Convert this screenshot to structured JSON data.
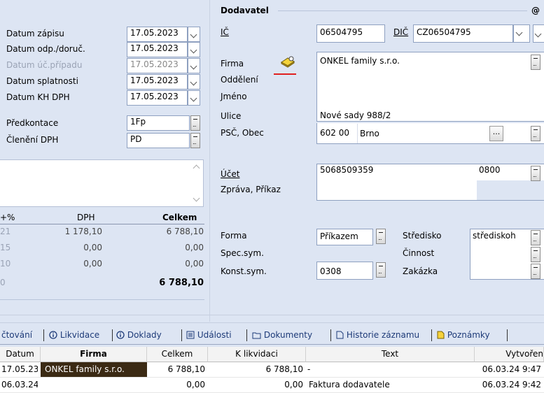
{
  "left": {
    "dates": [
      {
        "label": "Datum zápisu",
        "value": "17.05.2023",
        "disabled": false
      },
      {
        "label": "Datum odp./doruč.",
        "value": "17.05.2023",
        "disabled": false
      },
      {
        "label": "Datum úč.případu",
        "value": "17.05.2023",
        "disabled": true
      },
      {
        "label": "Datum splatnosti",
        "value": "17.05.2023",
        "disabled": false
      },
      {
        "label": "Datum KH DPH",
        "value": "17.05.2023",
        "disabled": false
      }
    ],
    "predkontace_label": "Předkontace",
    "predkontace_value": "1Fp",
    "cleneni_label": "Členění DPH",
    "cleneni_value": "PD",
    "vat_headers": {
      "rate": "+%",
      "dph": "DPH",
      "celkem": "Celkem"
    },
    "vat_rows": [
      {
        "rate": "21",
        "dph": "1 178,10",
        "celkem": "6 788,10"
      },
      {
        "rate": "15",
        "dph": "0,00",
        "celkem": "0,00"
      },
      {
        "rate": "10",
        "dph": "0,00",
        "celkem": "0,00"
      },
      {
        "rate": "0",
        "dph": "",
        "celkem": "6 788,10"
      }
    ]
  },
  "supplier": {
    "section_title": "Dodavatel",
    "at_symbol": "@",
    "ic_label": "IČ",
    "ic_value": "06504795",
    "dic_label": "DIČ",
    "dic_value": "CZ06504795",
    "firma_label": "Firma",
    "firma_value": "ONKEL family s.r.o.",
    "oddeleni_label": "Oddělení",
    "jmeno_label": "Jméno",
    "ulice_label": "Ulice",
    "ulice_value": "Nové sady 988/2",
    "psc_label": "PSČ, Obec",
    "psc_value": "602 00",
    "obec_value": "Brno",
    "dots_label": "...",
    "ucet_label": "Účet",
    "ucet_value": "5068509359",
    "bank_code": "0800",
    "zprava_label": "Zpráva, Příkaz",
    "forma_label": "Forma",
    "forma_value": "Příkazem",
    "spec_label": "Spec.sym.",
    "konst_label": "Konst.sym.",
    "konst_value": "0308",
    "stredisko_label": "Středisko",
    "stredisko_value": "střediskoh",
    "cinnost_label": "Činnost",
    "zakazka_label": "Zakázka"
  },
  "tabs": [
    {
      "label": "čtování",
      "icon": "none"
    },
    {
      "label": "Likvidace",
      "icon": "info-icon"
    },
    {
      "label": "Doklady",
      "icon": "info-icon"
    },
    {
      "label": "Události",
      "icon": "list-icon"
    },
    {
      "label": "Dokumenty",
      "icon": "folder-icon"
    },
    {
      "label": "Historie záznamu",
      "icon": "document-icon"
    },
    {
      "label": "Poznámky",
      "icon": "note-icon"
    }
  ],
  "grid": {
    "headers": [
      "Datum",
      "Firma",
      "Celkem",
      "K likvidaci",
      "Text",
      "Vytvořen"
    ],
    "rows": [
      [
        "17.05.23",
        "ONKEL family s.r.o.",
        "6 788,10",
        "6 788,10",
        "-",
        "06.03.24 9:47"
      ],
      [
        "06.03.24",
        "",
        "0,00",
        "0,00",
        "Faktura dodavatele",
        "06.03.24 9:42"
      ]
    ]
  },
  "colors": {
    "background": "#dde5f3",
    "selected_row": "#3b2a14",
    "accent_red": "#e02020"
  }
}
